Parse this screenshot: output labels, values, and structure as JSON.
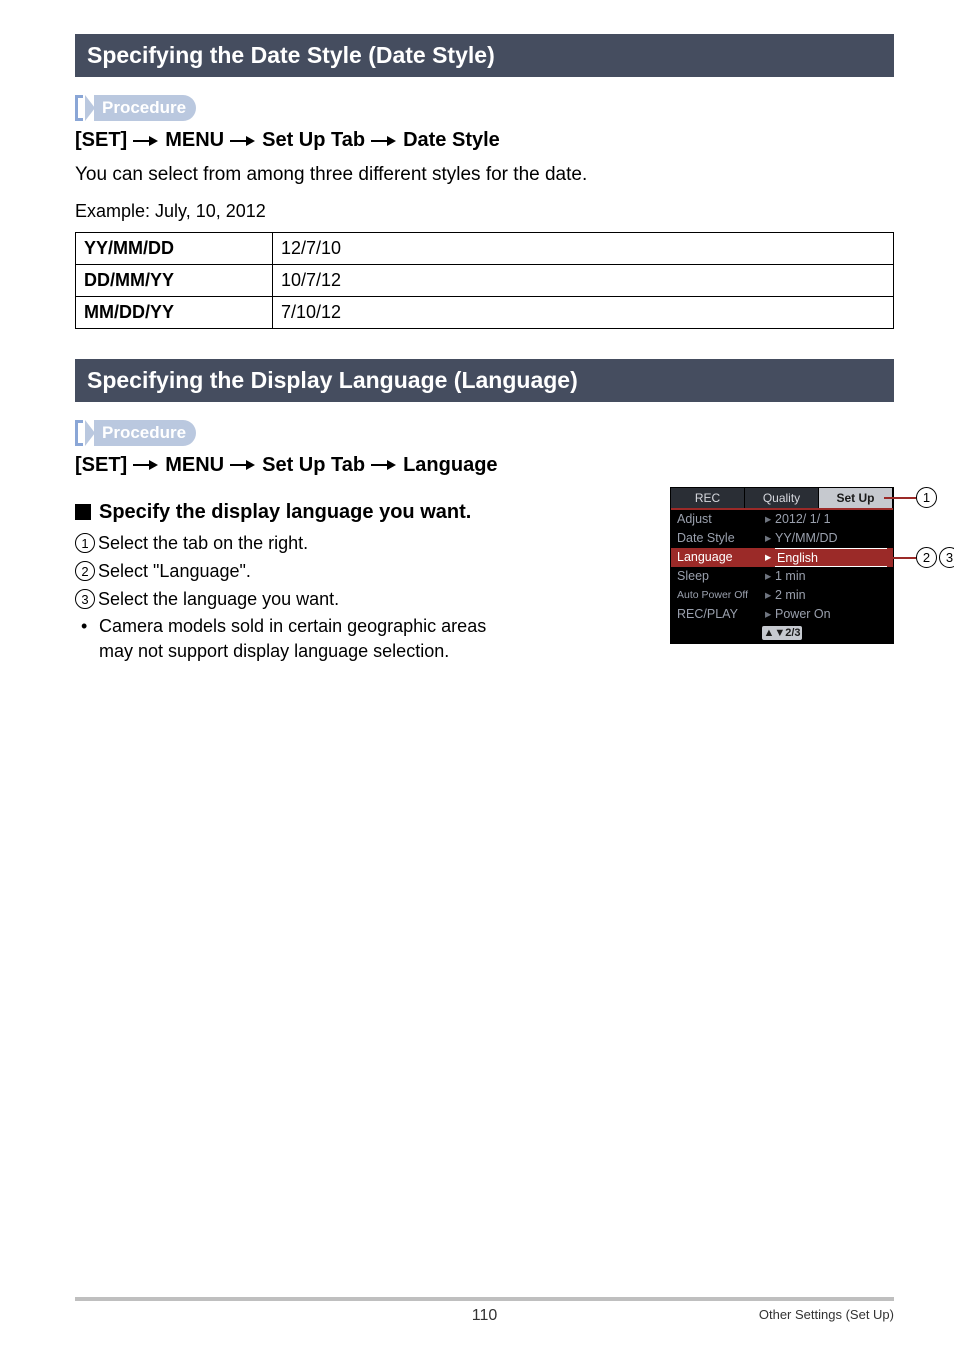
{
  "section1": {
    "title": "Specifying the Date Style (Date Style)",
    "procedure_label": "Procedure",
    "breadcrumb": [
      "[SET]",
      "MENU",
      "Set Up Tab",
      "Date Style"
    ],
    "desc": "You can select from among three different styles for the date.",
    "example_label": "Example: July, 10, 2012",
    "table": [
      {
        "fmt": "YY/MM/DD",
        "val": "12/7/10"
      },
      {
        "fmt": "DD/MM/YY",
        "val": "10/7/12"
      },
      {
        "fmt": "MM/DD/YY",
        "val": "7/10/12"
      }
    ]
  },
  "section2": {
    "title": "Specifying the Display Language (Language)",
    "procedure_label": "Procedure",
    "breadcrumb": [
      "[SET]",
      "MENU",
      "Set Up Tab",
      "Language"
    ],
    "subheading": "Specify the display language you want.",
    "steps": [
      "Select the tab on the right.",
      "Select \"Language\".",
      "Select the language you want."
    ],
    "note_line1": "Camera models sold in certain geographic areas",
    "note_line2": "may not support display language selection."
  },
  "camera": {
    "tabs": [
      "REC",
      "Quality",
      "Set Up"
    ],
    "rows": [
      {
        "label": "Adjust",
        "value": "2012/  1/  1"
      },
      {
        "label": "Date Style",
        "value": "YY/MM/DD"
      },
      {
        "label": "Language",
        "value": "English",
        "selected": true
      },
      {
        "label": "Sleep",
        "value": "1 min"
      },
      {
        "label": "Auto Power Off",
        "value": "2 min"
      },
      {
        "label": "REC/PLAY",
        "value": "Power On"
      }
    ],
    "footer": "▲▼2/3"
  },
  "callouts": {
    "n1": "1",
    "n2": "2",
    "n3": "3"
  },
  "footer": {
    "page": "110",
    "section": "Other Settings (Set Up)"
  }
}
